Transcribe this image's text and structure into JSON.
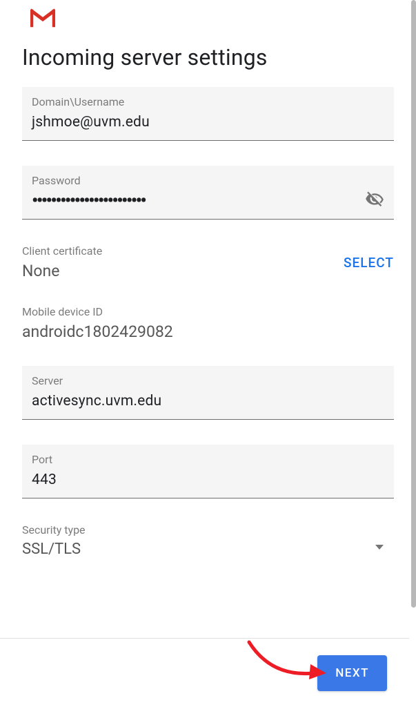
{
  "header": {
    "title": "Incoming server settings"
  },
  "fields": {
    "username": {
      "label": "Domain\\Username",
      "value": "jshmoe@uvm.edu"
    },
    "password": {
      "label": "Password",
      "value": "••••••••••••••••••••••••"
    },
    "server": {
      "label": "Server",
      "value": "activesync.uvm.edu"
    },
    "port": {
      "label": "Port",
      "value": "443"
    }
  },
  "client_certificate": {
    "label": "Client certificate",
    "value": "None",
    "action_label": "SELECT"
  },
  "mobile_device_id": {
    "label": "Mobile device ID",
    "value": "androidc1802429082"
  },
  "security_type": {
    "label": "Security type",
    "value": "SSL/TLS"
  },
  "footer": {
    "next_label": "NEXT"
  }
}
